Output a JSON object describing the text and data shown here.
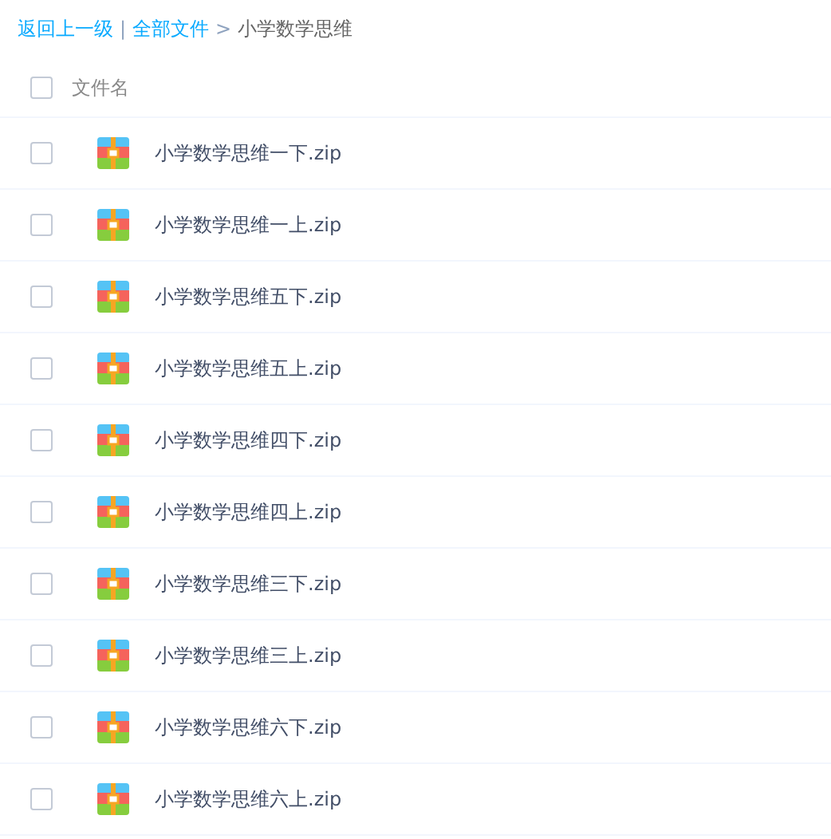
{
  "breadcrumb": {
    "back": "返回上一级",
    "divider": "|",
    "root": "全部文件",
    "arrow": ">",
    "current": "小学数学思维"
  },
  "header": {
    "checked": false,
    "label": "文件名"
  },
  "files": [
    {
      "name": "小学数学思维一下.zip",
      "checked": false
    },
    {
      "name": "小学数学思维一上.zip",
      "checked": false
    },
    {
      "name": "小学数学思维五下.zip",
      "checked": false
    },
    {
      "name": "小学数学思维五上.zip",
      "checked": false
    },
    {
      "name": "小学数学思维四下.zip",
      "checked": false
    },
    {
      "name": "小学数学思维四上.zip",
      "checked": false
    },
    {
      "name": "小学数学思维三下.zip",
      "checked": false
    },
    {
      "name": "小学数学思维三上.zip",
      "checked": false
    },
    {
      "name": "小学数学思维六下.zip",
      "checked": false
    },
    {
      "name": "小学数学思维六上.zip",
      "checked": false
    }
  ]
}
